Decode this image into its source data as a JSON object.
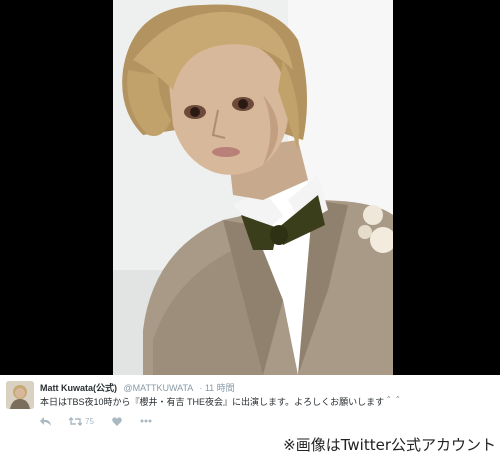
{
  "photo": {
    "description_icon": "selfie-photo"
  },
  "tweet": {
    "author_name": "Matt Kuwata(公式)",
    "handle": "@MATTKUWATA",
    "time": "· 11 時間",
    "text": "本日はTBS夜10時から『櫻井・有吉 THE夜会』に出演します。よろしくお願いします＾＾",
    "actions": [
      {
        "icon": "reply-icon",
        "count": ""
      },
      {
        "icon": "retweet-icon",
        "count": "75"
      },
      {
        "icon": "like-icon",
        "count": ""
      },
      {
        "icon": "more-icon",
        "count": ""
      }
    ]
  },
  "caption": "※画像はTwitter公式アカウント",
  "colors": {
    "background": "#000000",
    "suit": "#a89a87",
    "bowtie": "#3b3e1a",
    "hair": "#c8a973"
  }
}
